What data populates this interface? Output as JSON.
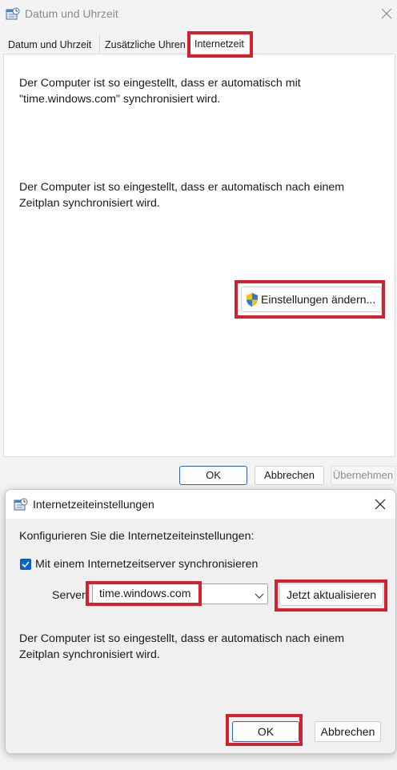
{
  "main_window": {
    "title": "Datum und Uhrzeit",
    "tabs": [
      {
        "label": "Datum und Uhrzeit",
        "active": false
      },
      {
        "label": "Zusätzliche Uhren",
        "active": false
      },
      {
        "label": "Internetzeit",
        "active": true
      }
    ],
    "sync_line1": "Der Computer ist so eingestellt, dass er automatisch mit",
    "sync_line2": "\"time.windows.com\" synchronisiert wird.",
    "schedule_line1": "Der Computer ist so eingestellt, dass er automatisch nach einem",
    "schedule_line2": "Zeitplan synchronisiert wird.",
    "change_settings_label": "Einstellungen ändern...",
    "ok_label": "OK",
    "cancel_label": "Abbrechen",
    "apply_label": "Übernehmen"
  },
  "dialog": {
    "title": "Internetzeiteinstellungen",
    "heading": "Konfigurieren Sie die Internetzeiteinstellungen:",
    "checkbox_label": "Mit einem Internetzeitserver synchronisieren",
    "checkbox_checked": true,
    "server_label": "Server:",
    "server_value": "time.windows.com",
    "update_now_label": "Jetzt aktualisieren",
    "schedule_line1": "Der Computer ist so eingestellt, dass er automatisch nach einem",
    "schedule_line2": "Zeitplan synchronisiert wird.",
    "ok_label": "OK",
    "cancel_label": "Abbrechen"
  },
  "colors": {
    "highlight": "#d22230",
    "accent": "#0a64c8"
  }
}
